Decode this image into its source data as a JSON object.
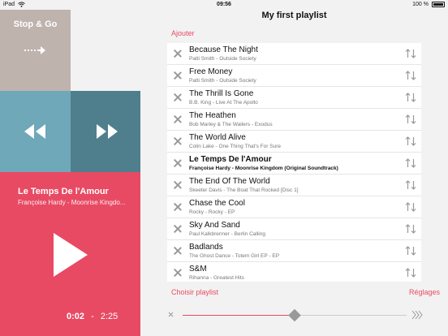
{
  "status_bar": {
    "device": "iPad",
    "time": "09:56",
    "battery": "100 %"
  },
  "left_panel": {
    "stop_go_title": "Stop & Go",
    "now_playing": {
      "title": "Le Temps De l'Amour",
      "artist": "Françoise Hardy - Moonrise Kingdo...",
      "elapsed": "0:02",
      "separator": "-",
      "duration": "2:25"
    },
    "colors": {
      "stop_go": "#bfb3ae",
      "prev": "#6fa8b8",
      "next": "#4f7f8c",
      "now": "#e84a63"
    }
  },
  "playlist": {
    "title": "My first playlist",
    "add_label": "Ajouter",
    "tracks": [
      {
        "title": "Because The Night",
        "subtitle": "Patti Smith - Outside Society"
      },
      {
        "title": "Free Money",
        "subtitle": "Patti Smith - Outside Society"
      },
      {
        "title": "The Thrill Is Gone",
        "subtitle": "B.B. King - Live At The Apollo"
      },
      {
        "title": "The Heathen",
        "subtitle": "Bob Marley & The Wailers - Exodus"
      },
      {
        "title": "The World Alive",
        "subtitle": "Colin Lake - One Thing That's For Sure"
      },
      {
        "title": "Le Temps De l'Amour",
        "subtitle": "Françoise Hardy - Moonrise Kingdom (Original Soundtrack)"
      },
      {
        "title": "The End Of The World",
        "subtitle": "Skeeter Davis - The Boat That Rocked [Disc 1]"
      },
      {
        "title": "Chase the Cool",
        "subtitle": "Rocky - Rocky - EP"
      },
      {
        "title": "Sky And Sand",
        "subtitle": "Paul Kalkbrenner - Berlin Calling"
      },
      {
        "title": "Badlands",
        "subtitle": "The Ghost Dance - Totem Girl EP - EP"
      },
      {
        "title": "S&M",
        "subtitle": "Rihanna - Greatest Hits"
      }
    ],
    "current_index": 5,
    "choose_playlist_label": "Choisir playlist",
    "settings_label": "Réglages"
  },
  "slider": {
    "value": 0.5,
    "accent": "#e84a63"
  }
}
